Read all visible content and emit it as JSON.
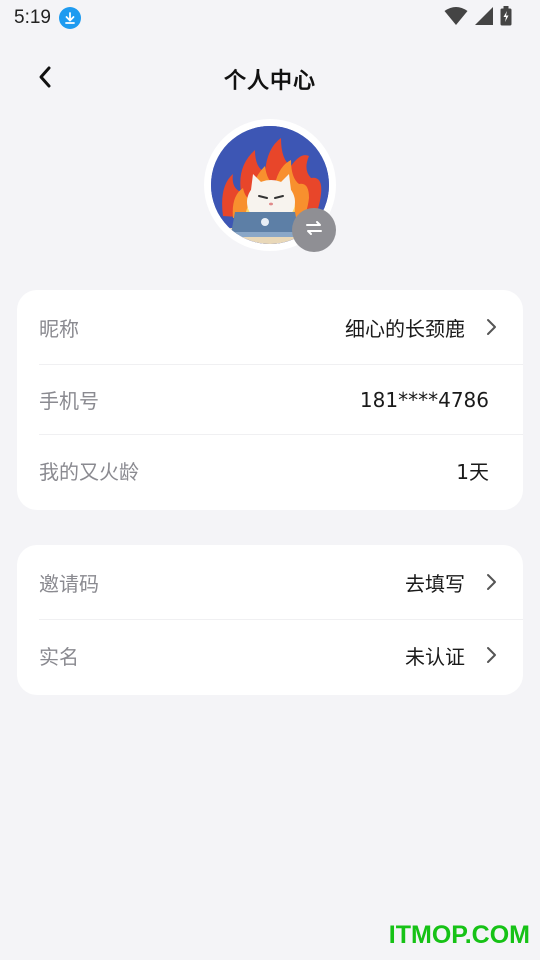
{
  "status_bar": {
    "time": "5:19",
    "download_icon": "download-icon",
    "wifi_icon": "wifi-icon",
    "signal_icon": "signal-icon",
    "battery_icon": "battery-charging-icon"
  },
  "nav": {
    "back_icon": "chevron-left-icon",
    "title": "个人中心"
  },
  "avatar": {
    "image": "cat-with-laptop-on-fire-avatar",
    "swap_icon": "swap-arrows-icon"
  },
  "profile_card": {
    "rows": [
      {
        "label": "昵称",
        "value": "细心的长颈鹿",
        "has_chevron": true
      },
      {
        "label": "手机号",
        "value": "181****4786",
        "has_chevron": false
      },
      {
        "label": "我的又火龄",
        "value": "1天",
        "has_chevron": false
      }
    ]
  },
  "extra_card": {
    "rows": [
      {
        "label": "邀请码",
        "value": "去填写",
        "has_chevron": true
      },
      {
        "label": "实名",
        "value": "未认证",
        "has_chevron": true
      }
    ]
  },
  "watermark": "ITMOP.COM",
  "colors": {
    "background": "#f4f4f7",
    "card": "#ffffff",
    "label": "#8a8a90",
    "accent_download": "#1e9bf0",
    "watermark": "#16c216"
  }
}
